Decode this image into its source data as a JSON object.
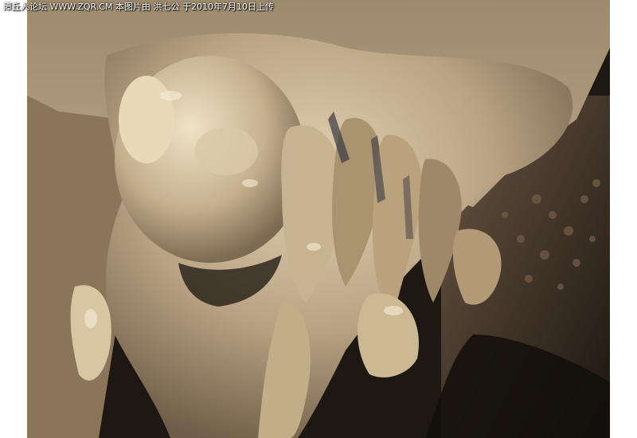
{
  "photo": {
    "subject": "cave-flowstone",
    "colors": {
      "rock_light": "#cdbb9a",
      "rock_mid": "#a08a6a",
      "rock_dark": "#5a4a38",
      "shadow": "#120e0b"
    }
  },
  "watermark": {
    "text": "潭丘人论坛 WWW.ZQR.CM 本图片由 洪七公 于2010年7月10日上传"
  }
}
